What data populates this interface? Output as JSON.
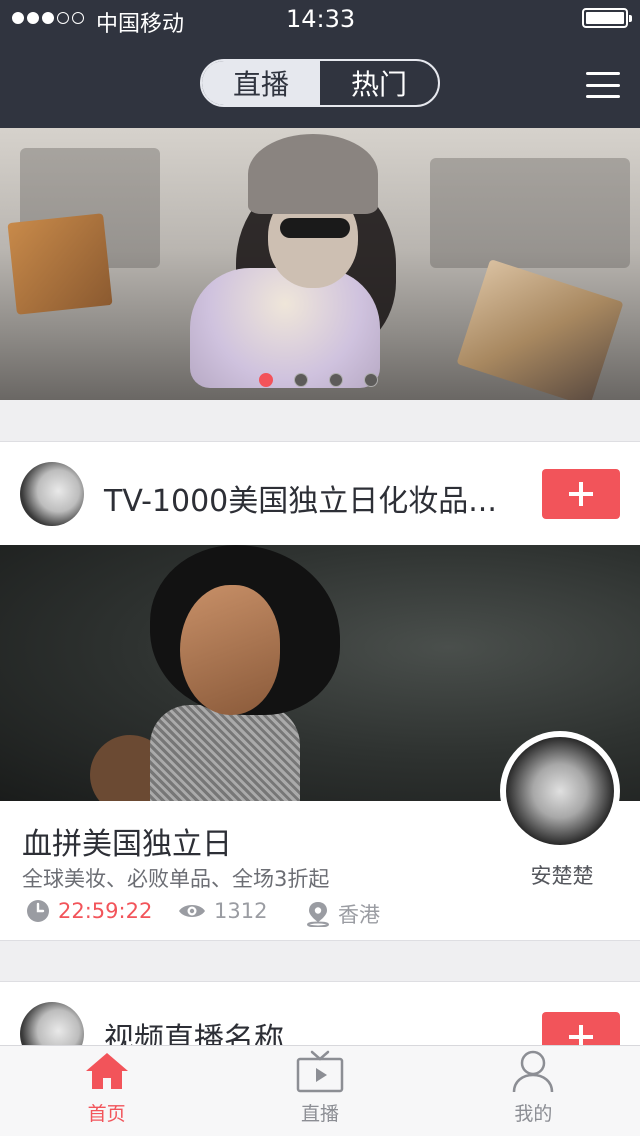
{
  "status_bar": {
    "carrier": "中国移动",
    "time": "14:33",
    "signal_filled": 3,
    "signal_total": 5,
    "battery_level": 1.0
  },
  "header": {
    "tabs": [
      {
        "label": "直播",
        "active": true
      },
      {
        "label": "热门",
        "active": false
      }
    ],
    "menu_icon": "hamburger-menu-icon"
  },
  "banner": {
    "page_count": 4,
    "active_page": 1
  },
  "feed": [
    {
      "title": "TV-1000美国独立日化妆品...",
      "follow_icon": "plus-icon",
      "live_title": "血拼美国独立日",
      "subtitle": "全球美妆、必败单品、全场3折起",
      "countdown": "22:59:22",
      "views": "1312",
      "location": "香港",
      "host_name": "安楚楚"
    },
    {
      "title": "视频直播名称",
      "follow_icon": "plus-icon"
    }
  ],
  "tab_bar": [
    {
      "label": "首页",
      "icon": "home-icon",
      "active": true
    },
    {
      "label": "直播",
      "icon": "tv-icon",
      "active": false
    },
    {
      "label": "我的",
      "icon": "user-icon",
      "active": false
    }
  ],
  "colors": {
    "header_bg": "#30343f",
    "accent": "#f2545a",
    "page_bg": "#efeff1"
  }
}
